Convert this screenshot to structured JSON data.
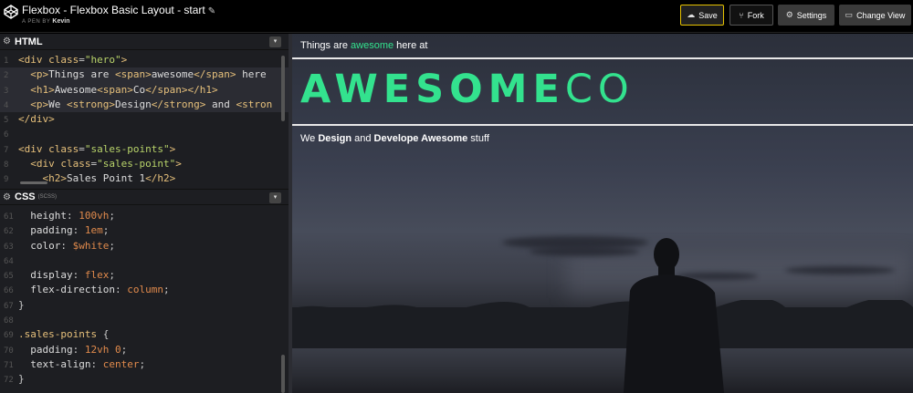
{
  "topbar": {
    "title": "Flexbox - Flexbox Basic Layout - start",
    "edit_glyph": "✎",
    "author_prefix": "A PEN BY",
    "author": "Kevin",
    "save_label": "Save",
    "fork_label": "Fork",
    "settings_label": "Settings",
    "change_view_label": "Change View",
    "save_icon": "cloud-icon",
    "fork_icon": "fork-icon",
    "settings_icon": "gear-icon",
    "change_view_icon": "layout-icon",
    "accent_color": "#e6c200"
  },
  "html_pane": {
    "title": "HTML",
    "lines": [
      {
        "n": "1",
        "html": "<span class='t-tag'>&lt;div</span> <span class='t-attr'>class</span>=<span class='t-str'>\"hero\"</span><span class='t-tag'>&gt;</span>"
      },
      {
        "n": "2",
        "html": "  <span class='t-tag'>&lt;p&gt;</span><span class='t-text'>Things are </span><span class='t-tag'>&lt;span&gt;</span><span class='t-text'>awesome</span><span class='t-tag'>&lt;/span&gt;</span><span class='t-text'> here</span>"
      },
      {
        "n": "3",
        "html": "  <span class='t-tag'>&lt;h1&gt;</span><span class='t-text'>Awesome</span><span class='t-tag'>&lt;span&gt;</span><span class='t-text'>Co</span><span class='t-tag'>&lt;/span&gt;&lt;/h1&gt;</span>"
      },
      {
        "n": "4",
        "html": "  <span class='t-tag'>&lt;p&gt;</span><span class='t-text'>We </span><span class='t-tag'>&lt;strong&gt;</span><span class='t-text'>Design</span><span class='t-tag'>&lt;/strong&gt;</span><span class='t-text'> and </span><span class='t-tag'>&lt;stron</span>"
      },
      {
        "n": "5",
        "html": "<span class='t-tag'>&lt;/div&gt;</span>"
      },
      {
        "n": "6",
        "html": ""
      },
      {
        "n": "7",
        "html": "<span class='t-tag'>&lt;div</span> <span class='t-attr'>class</span>=<span class='t-str'>\"sales-points\"</span><span class='t-tag'>&gt;</span>"
      },
      {
        "n": "8",
        "html": "  <span class='t-tag'>&lt;div</span> <span class='t-attr'>class</span>=<span class='t-str'>\"sales-point\"</span><span class='t-tag'>&gt;</span>"
      },
      {
        "n": "9",
        "html": "    <span class='t-tag'>&lt;h2&gt;</span><span class='t-text'>Sales Point 1</span><span class='t-tag'>&lt;/h2&gt;</span>"
      }
    ]
  },
  "css_pane": {
    "title": "CSS",
    "subtitle": "(SCSS)",
    "lines": [
      {
        "n": "61",
        "html": "  <span class='t-prop'>height</span>: <span class='t-num'>100vh</span>;"
      },
      {
        "n": "62",
        "html": "  <span class='t-prop'>padding</span>: <span class='t-num'>1em</span>;"
      },
      {
        "n": "63",
        "html": "  <span class='t-prop'>color</span>: <span class='t-var'>$white</span>;"
      },
      {
        "n": "64",
        "html": ""
      },
      {
        "n": "65",
        "html": "  <span class='t-prop'>display</span>: <span class='t-num'>flex</span>;"
      },
      {
        "n": "66",
        "html": "  <span class='t-prop'>flex-direction</span>: <span class='t-num'>column</span>;"
      },
      {
        "n": "67",
        "html": "}"
      },
      {
        "n": "68",
        "html": ""
      },
      {
        "n": "69",
        "html": "<span class='t-sel'>.sales-points</span> {"
      },
      {
        "n": "70",
        "html": "  <span class='t-prop'>padding</span>: <span class='t-num'>12vh 0</span>;"
      },
      {
        "n": "71",
        "html": "  <span class='t-prop'>text-align</span>: <span class='t-num'>center</span>;"
      },
      {
        "n": "72",
        "html": "}"
      }
    ]
  },
  "preview": {
    "hero_p_prefix": "Things are ",
    "hero_p_accent": "awesome",
    "hero_p_suffix": " here at",
    "h1_strong": "AWESOME",
    "h1_light": "CO",
    "p2_a": "We ",
    "p2_b": "Design",
    "p2_c": " and ",
    "p2_d": "Develope Awesome",
    "p2_e": " stuff",
    "accent_color": "#33e28e"
  }
}
